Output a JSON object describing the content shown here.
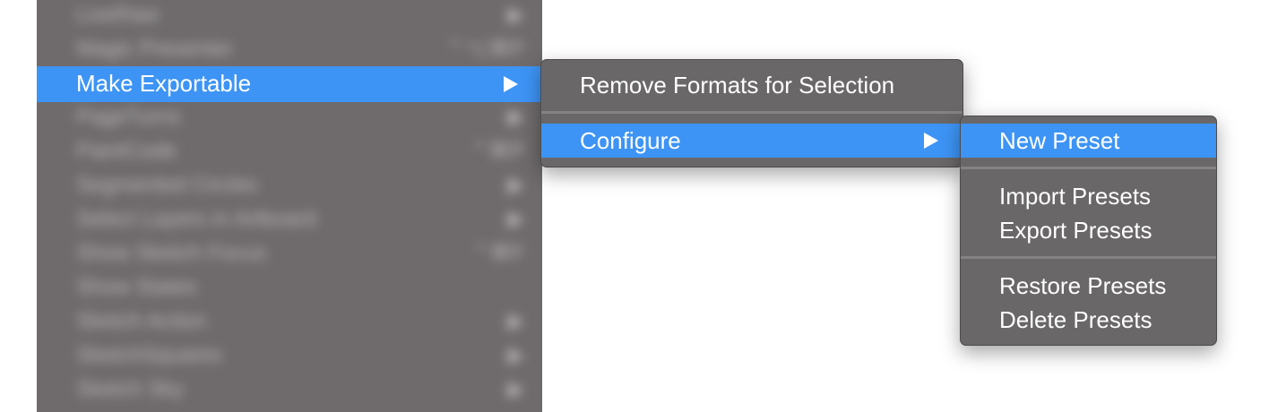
{
  "parent_menu": {
    "blurred_items": [
      {
        "label": "LiveRaw",
        "shortcut": "▶"
      },
      {
        "label": "Magic Presenter",
        "shortcut": "⌃⌥⌘P"
      },
      {
        "label": "",
        "shortcut": ""
      },
      {
        "label": "PageTurns",
        "shortcut": "▶"
      },
      {
        "label": "PaintCode",
        "shortcut": "⌃⌘P"
      },
      {
        "label": "Segmented Circles",
        "shortcut": "▶"
      },
      {
        "label": "Select Layers in Artboard",
        "shortcut": "▶"
      },
      {
        "label": "Show Sketch Focus",
        "shortcut": "⌃⌘F"
      },
      {
        "label": "Show States",
        "shortcut": ""
      },
      {
        "label": "Sketch Action",
        "shortcut": "▶"
      },
      {
        "label": "SketchSquares",
        "shortcut": "▶"
      },
      {
        "label": "Sketch Sky",
        "shortcut": "▶"
      }
    ],
    "highlighted_item": "Make Exportable"
  },
  "submenu_make_exportable": {
    "items": [
      "Remove Formats for Selection",
      "Configure"
    ]
  },
  "submenu_configure": {
    "items": [
      "New Preset",
      "Import Presets",
      "Export Presets",
      "Restore Presets",
      "Delete Presets"
    ]
  },
  "colors": {
    "highlight": "#3d94f5",
    "menu_bg": "#6a6769"
  }
}
